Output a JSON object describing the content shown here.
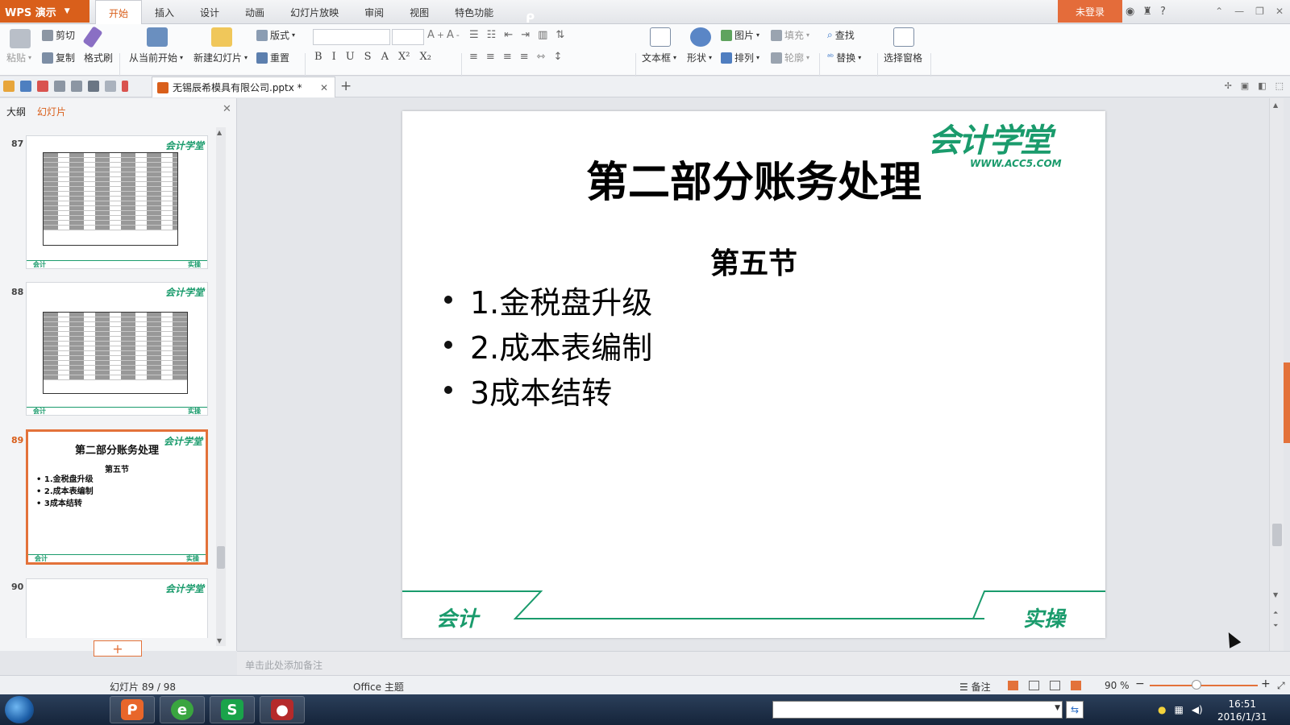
{
  "app": {
    "menu_label": "WPS 演示",
    "login": "未登录",
    "tabs": [
      "开始",
      "插入",
      "设计",
      "动画",
      "幻灯片放映",
      "审阅",
      "视图",
      "特色功能"
    ]
  },
  "ribbon": {
    "paste": "粘贴",
    "cut": "剪切",
    "copy": "复制",
    "format_painter": "格式刷",
    "from_current": "从当前开始",
    "new_slide": "新建幻灯片",
    "layout": "版式",
    "reset": "重置",
    "textbox": "文本框",
    "shape": "形状",
    "picture": "图片",
    "fill": "填充",
    "arrange": "排列",
    "outline": "轮廓",
    "find": "查找",
    "replace": "替换",
    "select_pane": "选择窗格"
  },
  "document": {
    "tab_title": "无锡辰希模具有限公司.pptx *"
  },
  "left_pane": {
    "tabs": [
      "大纲",
      "幻灯片"
    ],
    "thumbnails": [
      {
        "num": "87"
      },
      {
        "num": "88"
      },
      {
        "num": "89",
        "title": "第二部分账务处理",
        "subtitle": "第五节",
        "items": [
          "1.金税盘升级",
          "2.成本表编制",
          "3成本结转"
        ]
      },
      {
        "num": "90"
      }
    ],
    "footer_left": "会计",
    "footer_right": "实操",
    "logo": "会计学堂"
  },
  "slide": {
    "logo_text": "会计学堂",
    "logo_url": "WWW.ACC5.COM",
    "title": "第二部分账务处理",
    "subtitle": "第五节",
    "bullets": [
      "1.金税盘升级",
      "2.成本表编制",
      "3成本结转"
    ],
    "footer_left": "会计",
    "footer_right": "实操"
  },
  "notes_placeholder": "单击此处添加备注",
  "status": {
    "slide_counter": "幻灯片 89 / 98",
    "theme": "Office 主题",
    "notes_btn": "备注",
    "zoom": "90 %"
  },
  "taskbar": {
    "time": "16:51",
    "date": "2016/1/31"
  },
  "colors": {
    "accent": "#d95f1b",
    "brand_green": "#1a9b6c"
  }
}
